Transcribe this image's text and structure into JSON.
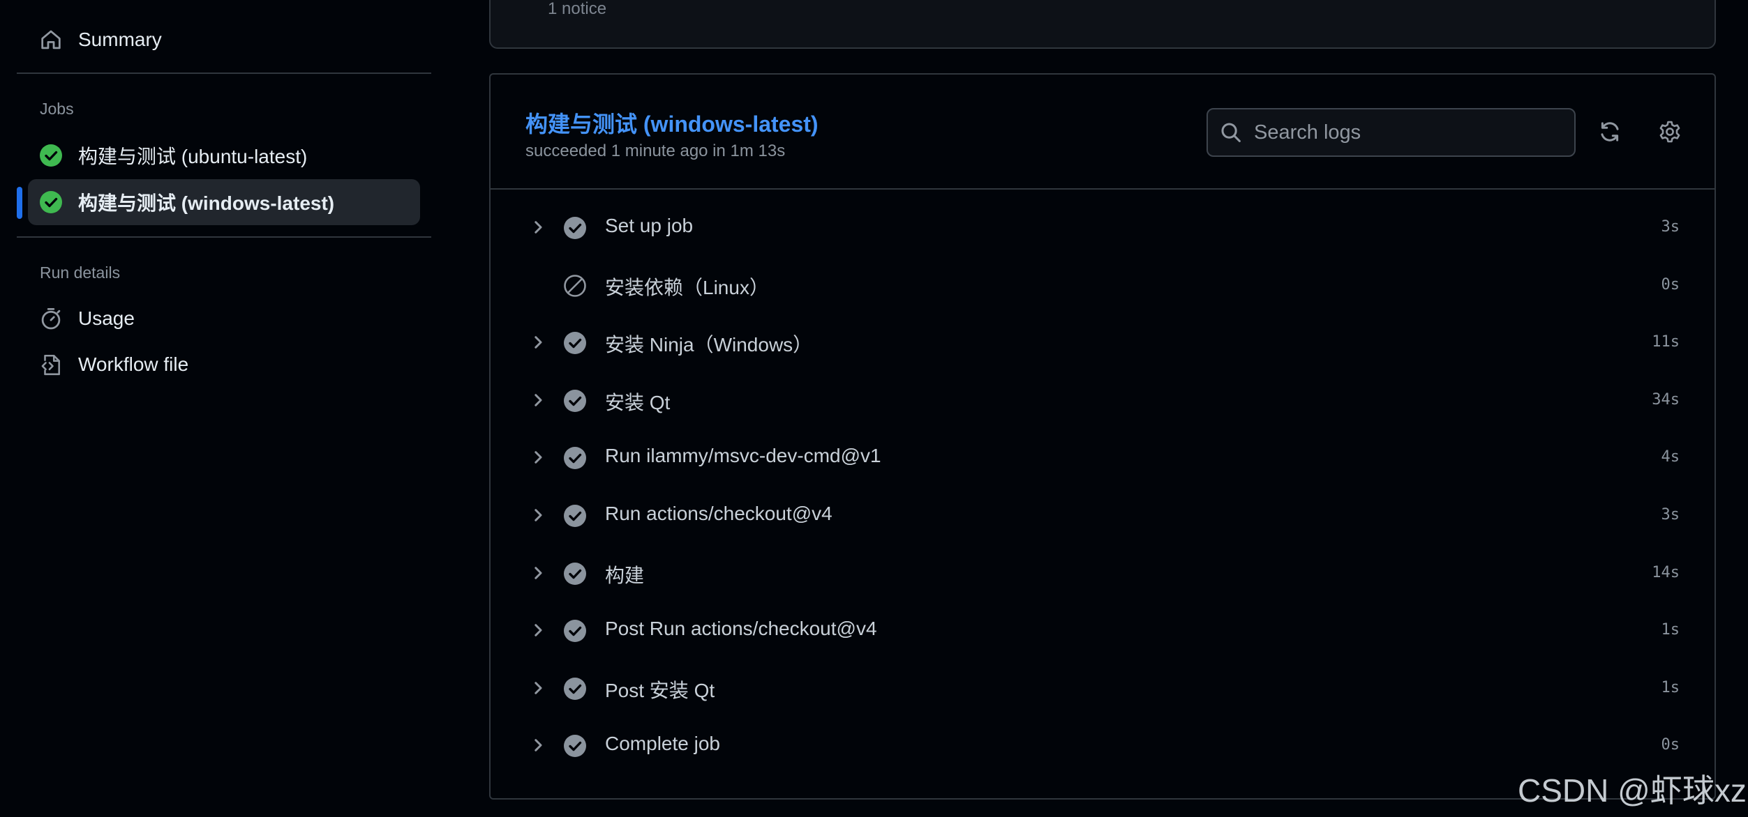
{
  "sidebar": {
    "summary_label": "Summary",
    "jobs_heading": "Jobs",
    "jobs": [
      {
        "label": "构建与测试 (ubuntu-latest)",
        "status": "success"
      },
      {
        "label": "构建与测试 (windows-latest)",
        "status": "success",
        "active": true
      }
    ],
    "run_details_heading": "Run details",
    "usage_label": "Usage",
    "workflow_file_label": "Workflow file"
  },
  "previous_card": {
    "notice_text": "1 notice"
  },
  "job": {
    "title": "构建与测试 (windows-latest)",
    "subtitle": "succeeded 1 minute ago in 1m 13s",
    "search": {
      "placeholder": "Search logs",
      "value": ""
    },
    "steps": [
      {
        "name": "Set up job",
        "duration": "3s",
        "status": "success",
        "expandable": true
      },
      {
        "name": "安装依赖（Linux）",
        "duration": "0s",
        "status": "skipped",
        "expandable": false
      },
      {
        "name": "安装 Ninja（Windows）",
        "duration": "11s",
        "status": "success",
        "expandable": true
      },
      {
        "name": "安装 Qt",
        "duration": "34s",
        "status": "success",
        "expandable": true
      },
      {
        "name": "Run ilammy/msvc-dev-cmd@v1",
        "duration": "4s",
        "status": "success",
        "expandable": true
      },
      {
        "name": "Run actions/checkout@v4",
        "duration": "3s",
        "status": "success",
        "expandable": true
      },
      {
        "name": "构建",
        "duration": "14s",
        "status": "success",
        "expandable": true
      },
      {
        "name": "Post Run actions/checkout@v4",
        "duration": "1s",
        "status": "success",
        "expandable": true
      },
      {
        "name": "Post 安装 Qt",
        "duration": "1s",
        "status": "success",
        "expandable": true
      },
      {
        "name": "Complete job",
        "duration": "0s",
        "status": "success",
        "expandable": true
      }
    ]
  },
  "watermark": "CSDN @虾球xz",
  "colors": {
    "accent_link": "#4493f8",
    "active_indicator": "#1f6feb",
    "success_green": "#3fb950",
    "step_check_gray": "#8b949e",
    "background": "#010409"
  },
  "icons": {
    "summary": "home-icon",
    "job_status": "check-circle-fill-icon",
    "usage": "stopwatch-icon",
    "workflow_file": "file-code-icon",
    "search": "search-icon",
    "refresh": "sync-icon",
    "settings": "gear-icon",
    "expand": "chevron-right-icon",
    "step_success": "check-circle-fill-icon",
    "step_skipped": "skip-icon"
  }
}
